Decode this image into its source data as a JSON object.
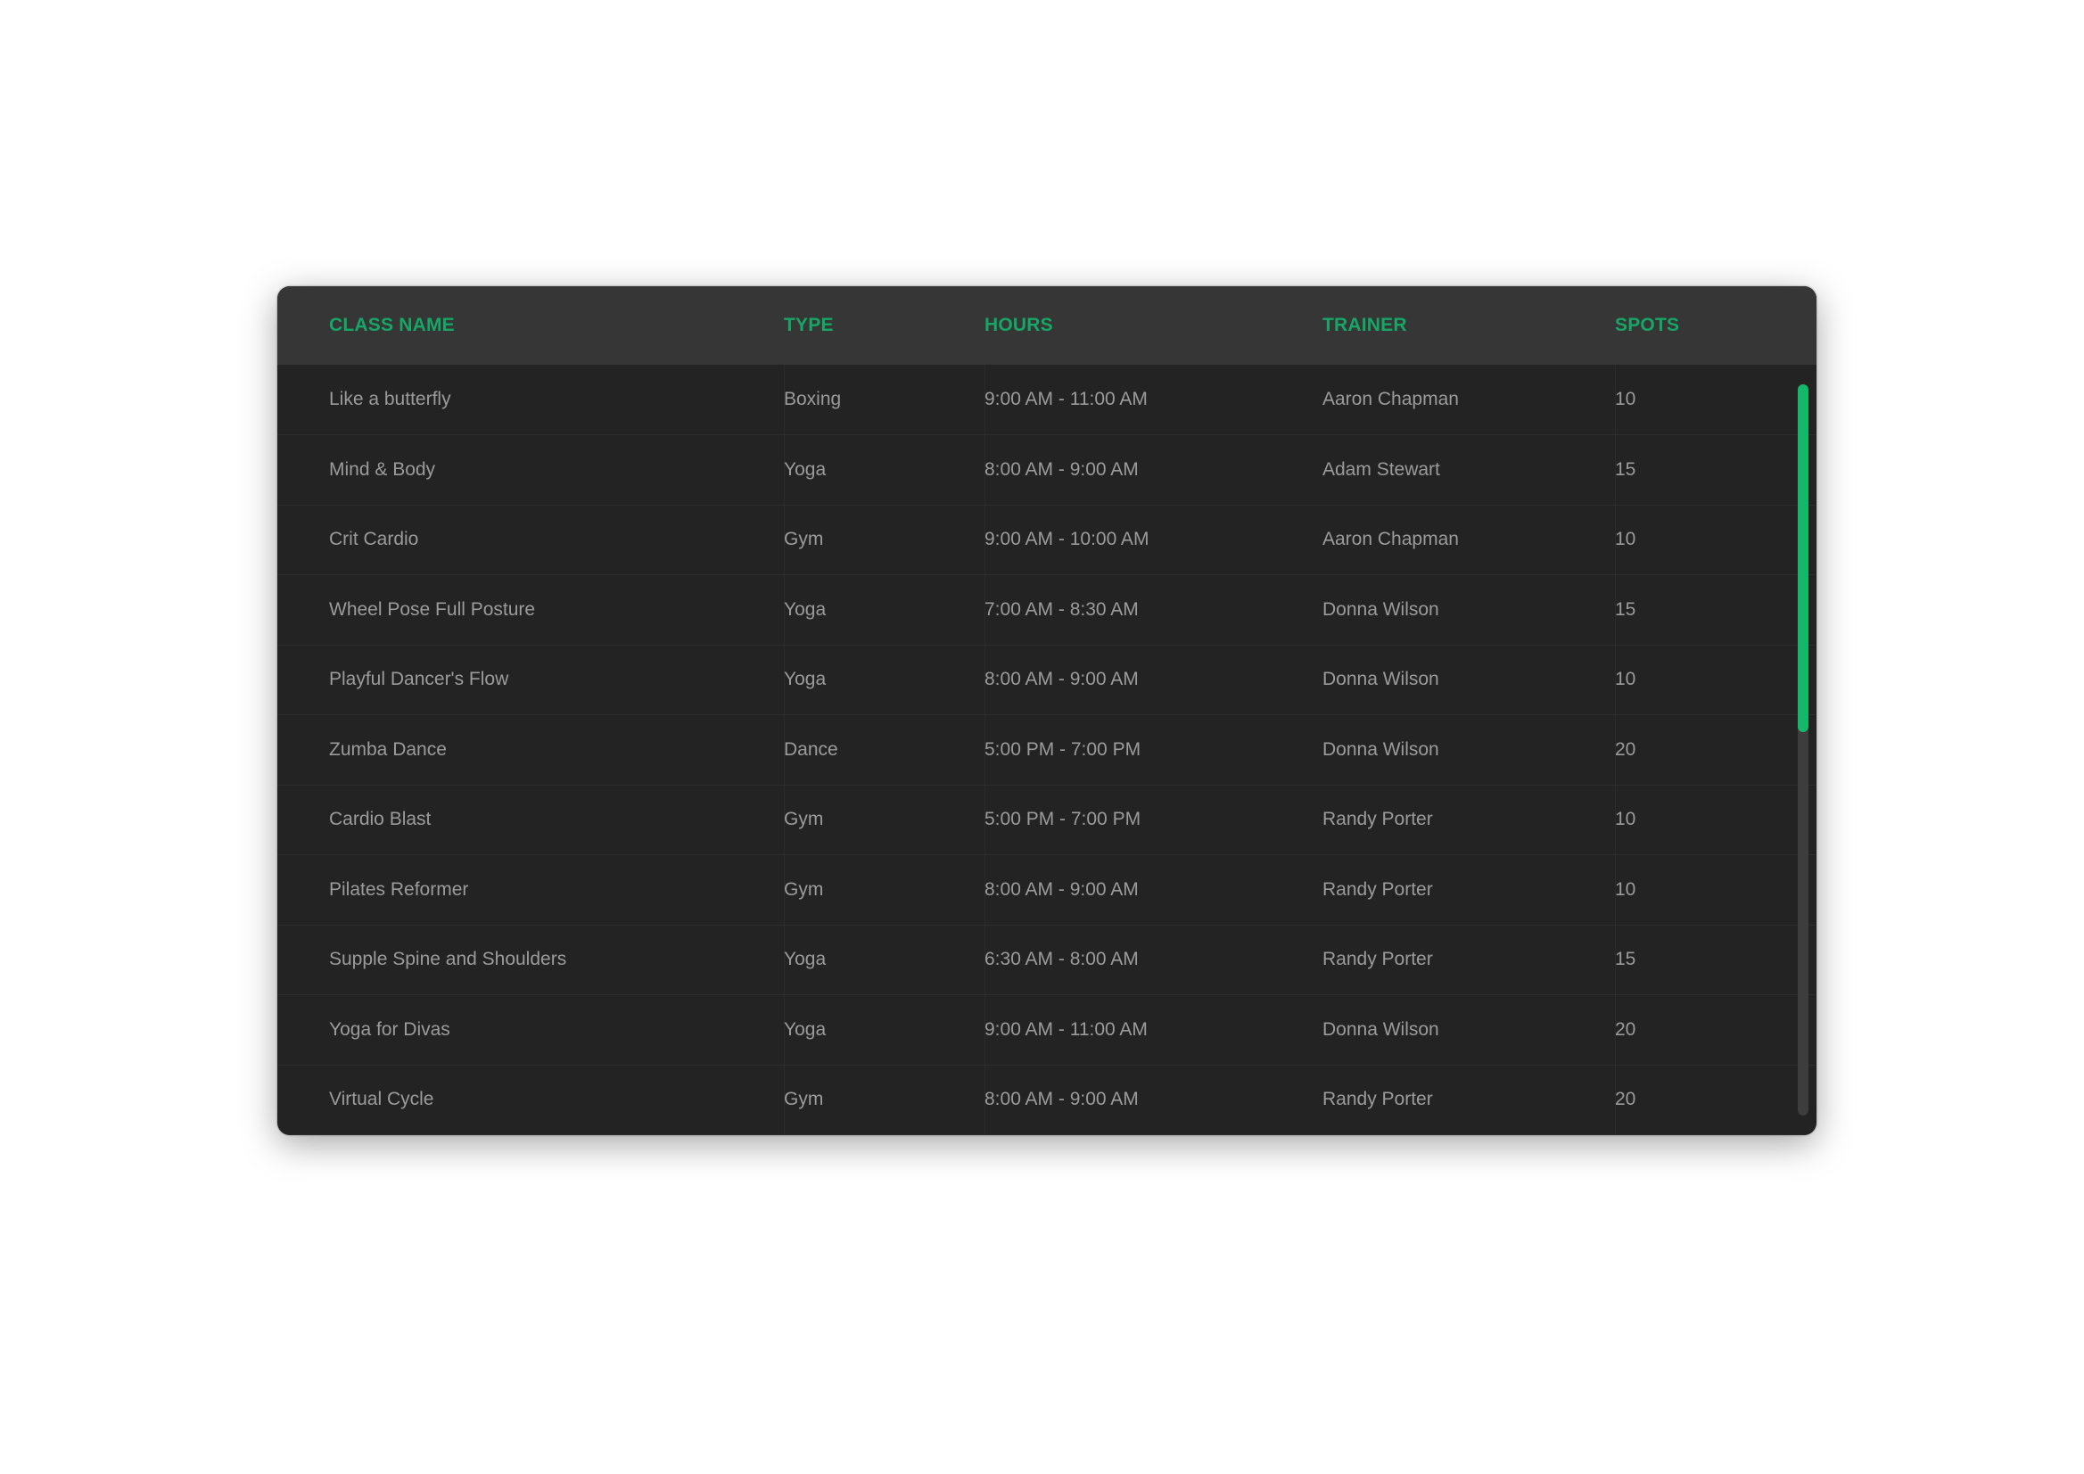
{
  "table": {
    "columns": [
      "CLASS NAME",
      "TYPE",
      "HOURS",
      "TRAINER",
      "SPOTS"
    ],
    "rows": [
      [
        "Like a butterfly",
        "Boxing",
        "9:00 AM - 11:00 AM",
        "Aaron Chapman",
        "10"
      ],
      [
        "Mind & Body",
        "Yoga",
        "8:00 AM - 9:00 AM",
        "Adam Stewart",
        "15"
      ],
      [
        "Crit Cardio",
        "Gym",
        "9:00 AM - 10:00 AM",
        "Aaron Chapman",
        "10"
      ],
      [
        "Wheel Pose Full Posture",
        "Yoga",
        "7:00 AM - 8:30 AM",
        "Donna Wilson",
        "15"
      ],
      [
        "Playful Dancer's Flow",
        "Yoga",
        "8:00 AM - 9:00 AM",
        "Donna Wilson",
        "10"
      ],
      [
        "Zumba Dance",
        "Dance",
        "5:00 PM - 7:00 PM",
        "Donna Wilson",
        "20"
      ],
      [
        "Cardio Blast",
        "Gym",
        "5:00 PM - 7:00 PM",
        "Randy Porter",
        "10"
      ],
      [
        "Pilates Reformer",
        "Gym",
        "8:00 AM - 9:00 AM",
        "Randy Porter",
        "10"
      ],
      [
        "Supple Spine and Shoulders",
        "Yoga",
        "6:30 AM - 8:00 AM",
        "Randy Porter",
        "15"
      ],
      [
        "Yoga for Divas",
        "Yoga",
        "9:00 AM - 11:00 AM",
        "Donna Wilson",
        "20"
      ],
      [
        "Virtual Cycle",
        "Gym",
        "8:00 AM - 9:00 AM",
        "Randy Porter",
        "20"
      ]
    ]
  },
  "colors": {
    "accent": "#16a766",
    "header_bg": "#363636",
    "body_bg": "#232323",
    "text": "#9b9b9b"
  }
}
